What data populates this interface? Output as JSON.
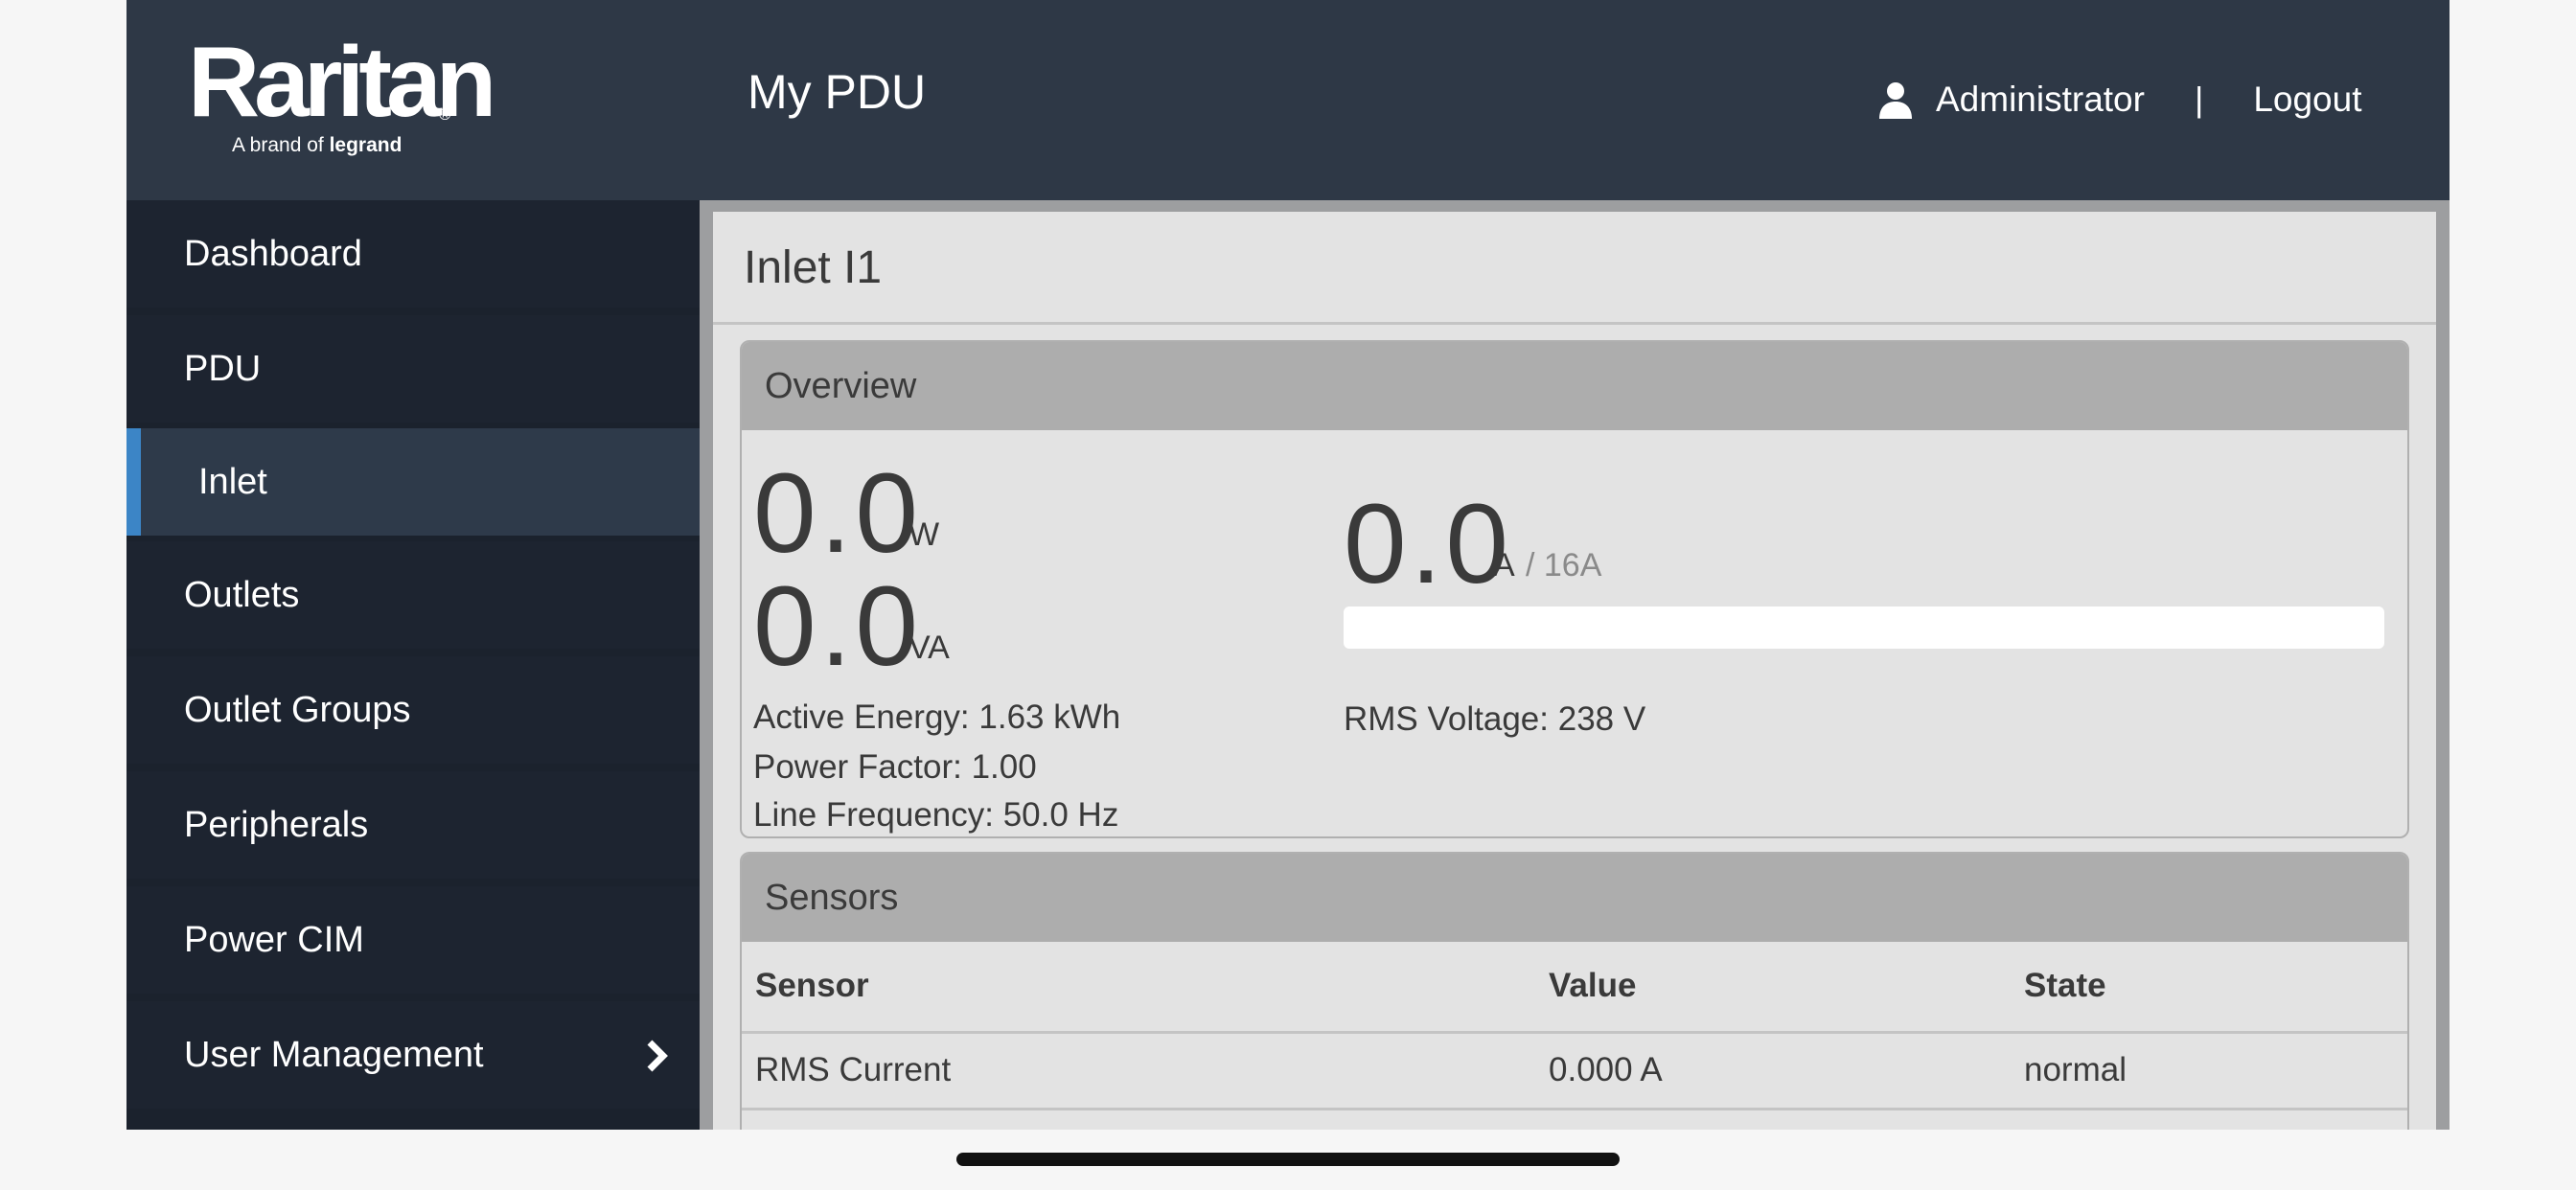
{
  "header": {
    "brand": "Raritan",
    "brand_reg": "®",
    "tagline_prefix": "A brand of",
    "tagline_brand": "legrand",
    "title": "My PDU",
    "user": "Administrator",
    "divider": "|",
    "logout": "Logout"
  },
  "sidebar": {
    "items": [
      {
        "label": "Dashboard"
      },
      {
        "label": "PDU"
      },
      {
        "label": "Inlet"
      },
      {
        "label": "Outlets"
      },
      {
        "label": "Outlet Groups"
      },
      {
        "label": "Peripherals"
      },
      {
        "label": "Power CIM"
      },
      {
        "label": "User Management"
      }
    ],
    "active_index": 2
  },
  "page": {
    "title": "Inlet I1"
  },
  "overview": {
    "heading": "Overview",
    "power_value": "0.0",
    "power_unit": "W",
    "apparent_value": "0.0",
    "apparent_unit": "VA",
    "current_value": "0.0",
    "current_unit": "A",
    "current_limit": "/ 16A",
    "current_fraction": 0.0,
    "active_energy": "Active Energy: 1.63 kWh",
    "power_factor": "Power Factor: 1.00",
    "line_frequency": "Line Frequency: 50.0 Hz",
    "rms_voltage": "RMS Voltage: 238 V"
  },
  "sensors": {
    "heading": "Sensors",
    "columns": [
      "Sensor",
      "Value",
      "State"
    ],
    "rows": [
      [
        "RMS Current",
        "0.000 A",
        "normal"
      ]
    ]
  },
  "colors": {
    "header_bg": "#2e3846",
    "sidebar_bg": "#1d2430",
    "active_accent": "#3c85c6",
    "panel_header": "#adadad",
    "content_bg": "#e3e3e3"
  },
  "icons": {
    "user": "user-icon",
    "chevron": "chevron-right-icon"
  }
}
